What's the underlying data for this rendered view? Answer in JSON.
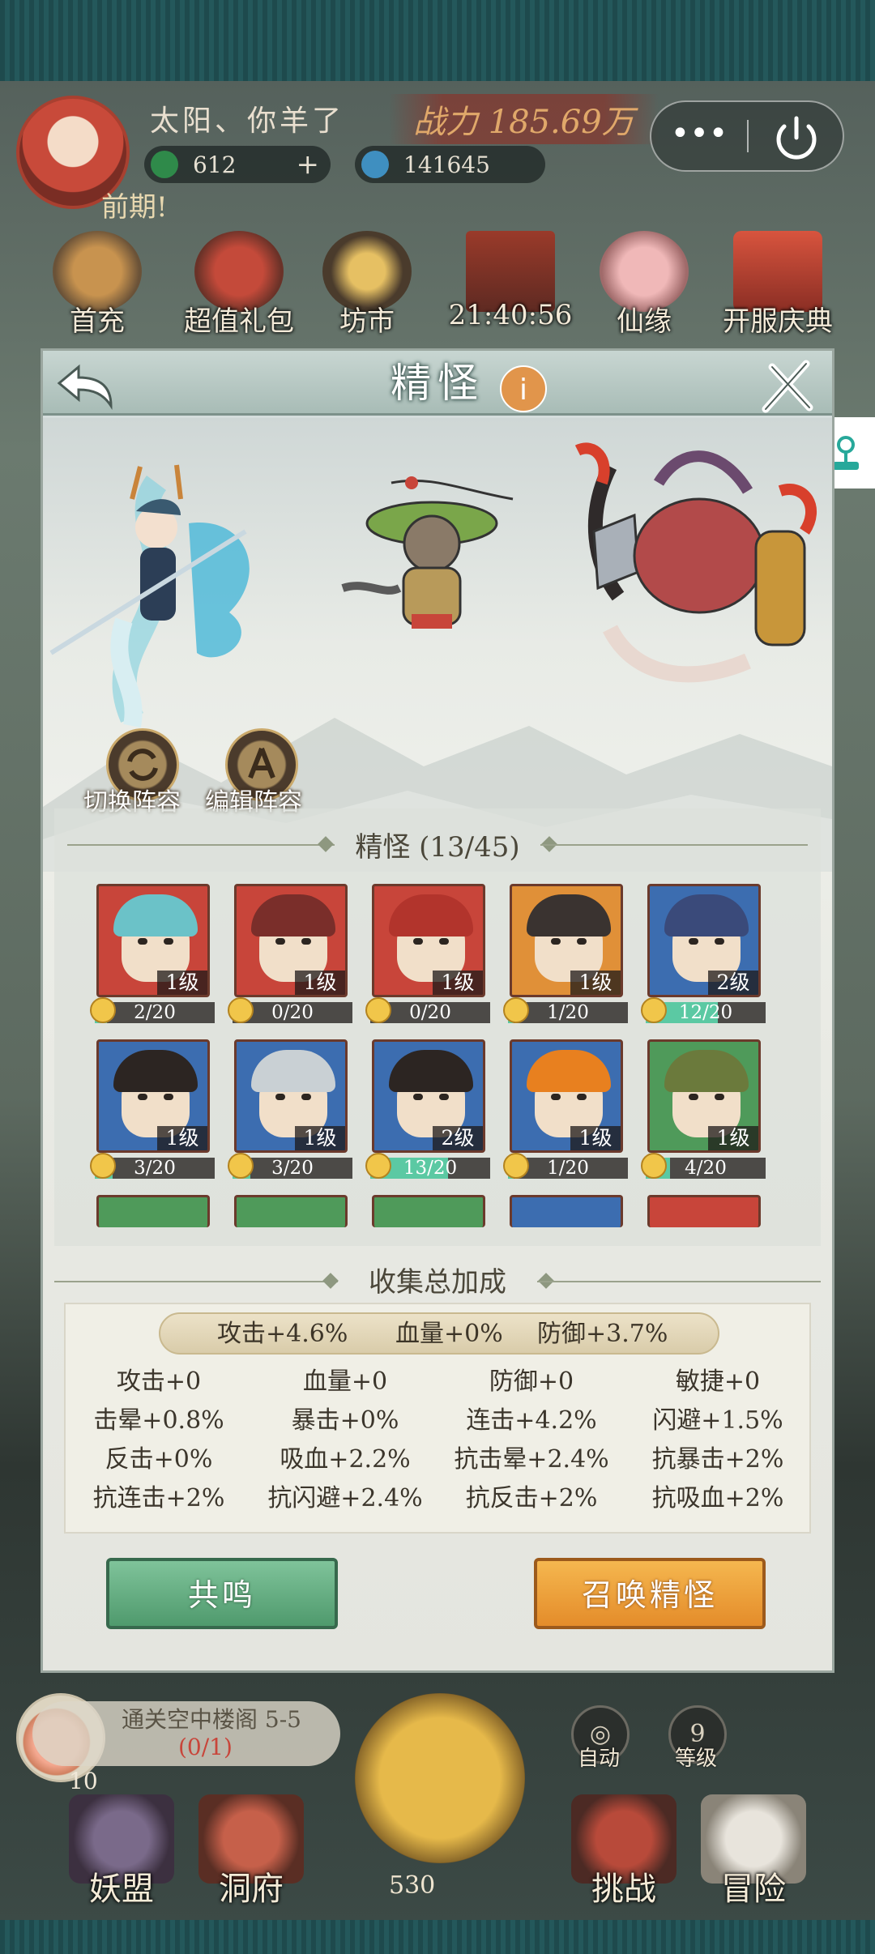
{
  "player": {
    "name": "太阳、你羊了",
    "power": "战力 185.69万",
    "jade": "612",
    "crystal": "141645",
    "phase": "前期!"
  },
  "events": [
    {
      "label": "首充"
    },
    {
      "label": "超值礼包"
    },
    {
      "label": "坊市"
    },
    {
      "label": "21:40:56"
    },
    {
      "label": "仙缘"
    },
    {
      "label": "开服庆典"
    }
  ],
  "quest": {
    "text": "通关空中楼阁 5-5",
    "progress": "(0/1)",
    "count": "10"
  },
  "bottom_nav": {
    "auto": "自动",
    "level_num": "9",
    "level": "等级",
    "axe_count": "530",
    "items": [
      "妖盟",
      "洞府",
      "挑战",
      "冒险"
    ]
  },
  "modal": {
    "title": "精怪",
    "info_icon": "i",
    "switch_lineup": "切换阵容",
    "edit_lineup": "编辑阵容",
    "collection_title": "精怪 (13/45)",
    "bonus_title": "收集总加成",
    "summary": [
      "攻击+4.6%",
      "血量+0%",
      "防御+3.7%"
    ],
    "bonus": [
      [
        "攻击+0",
        "血量+0",
        "防御+0",
        "敏捷+0"
      ],
      [
        "击晕+0.8%",
        "暴击+0%",
        "连击+4.2%",
        "闪避+1.5%"
      ],
      [
        "反击+0%",
        "吸血+2.2%",
        "抗击晕+2.4%",
        "抗暴击+2%"
      ],
      [
        "抗连击+2%",
        "抗闪避+2.4%",
        "抗反击+2%",
        "抗吸血+2%"
      ]
    ],
    "resonate_button": "共鸣",
    "summon_button": "召唤精怪"
  },
  "cards": [
    {
      "level": "1级",
      "progress": "2/20",
      "fill": 0.1,
      "bg": "#c8453a",
      "hair": "#6bc2c8"
    },
    {
      "level": "1级",
      "progress": "0/20",
      "fill": 0.0,
      "bg": "#c8453a",
      "hair": "#7a2e2a"
    },
    {
      "level": "1级",
      "progress": "0/20",
      "fill": 0.0,
      "bg": "#c8453a",
      "hair": "#b2342c"
    },
    {
      "level": "1级",
      "progress": "1/20",
      "fill": 0.05,
      "bg": "#e09038",
      "hair": "#3a3330"
    },
    {
      "level": "2级",
      "progress": "12/20",
      "fill": 0.6,
      "bg": "#3c6db0",
      "hair": "#3a4a7a"
    },
    {
      "level": "1级",
      "progress": "3/20",
      "fill": 0.15,
      "bg": "#3c6db0",
      "hair": "#2c2522"
    },
    {
      "level": "1级",
      "progress": "3/20",
      "fill": 0.15,
      "bg": "#3c6db0",
      "hair": "#c9d0d4"
    },
    {
      "level": "2级",
      "progress": "13/20",
      "fill": 0.65,
      "bg": "#3c6db0",
      "hair": "#2c2522"
    },
    {
      "level": "1级",
      "progress": "1/20",
      "fill": 0.05,
      "bg": "#3c6db0",
      "hair": "#e8801f"
    },
    {
      "level": "1级",
      "progress": "4/20",
      "fill": 0.2,
      "bg": "#4f9a5a",
      "hair": "#6b7a3c"
    }
  ],
  "partial_cards": [
    "#4f9a5a",
    "#4f9a5a",
    "#4f9a5a",
    "#3c6db0",
    "#c8453a"
  ],
  "colors": {
    "accent_green": "#5bc9a3",
    "accent_orange": "#e48c2a",
    "brand_red": "#c8453a"
  }
}
